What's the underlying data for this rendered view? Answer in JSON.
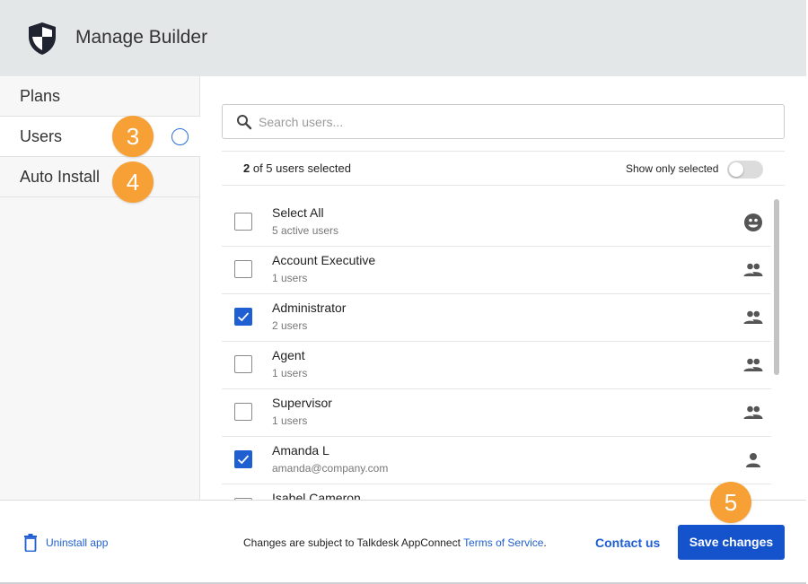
{
  "app": {
    "title": "Manage Builder",
    "logo_icon": "shield-icon"
  },
  "sidebar": {
    "items": [
      {
        "label": "Plans"
      },
      {
        "label": "Users"
      },
      {
        "label": "Auto Install"
      }
    ]
  },
  "markers": {
    "users": "3",
    "auto_install": "4",
    "save": "5",
    "color": "#f7a035"
  },
  "search": {
    "placeholder": "Search users...",
    "value": ""
  },
  "selection": {
    "count": "2",
    "count_text": " of 5 users selected",
    "show_only_label": "Show only selected",
    "show_only_on": false
  },
  "list": {
    "rows": [
      {
        "name": "Select All",
        "sub": "5 active users",
        "checked": false,
        "icon": "select-all-icon"
      },
      {
        "name": "Account Executive",
        "sub": "1 users",
        "checked": false,
        "icon": "group-icon"
      },
      {
        "name": "Administrator",
        "sub": "2 users",
        "checked": true,
        "icon": "group-icon"
      },
      {
        "name": "Agent",
        "sub": "1 users",
        "checked": false,
        "icon": "group-icon"
      },
      {
        "name": "Supervisor",
        "sub": "1 users",
        "checked": false,
        "icon": "group-icon"
      },
      {
        "name": "Amanda L",
        "sub": "amanda@company.com",
        "checked": true,
        "icon": "person-icon"
      },
      {
        "name": "Isabel Cameron",
        "sub": "",
        "checked": false,
        "icon": "person-icon"
      }
    ]
  },
  "footer": {
    "uninstall_label": "Uninstall app",
    "terms_prefix": "Changes are subject to Talkdesk AppConnect ",
    "terms_link": "Terms of Service",
    "terms_suffix": ".",
    "contact_label": "Contact us",
    "save_label": "Save changes"
  },
  "colors": {
    "accent": "#1f5fd1",
    "primary_button": "#1553cc",
    "header_bg": "#e4e7e8"
  }
}
